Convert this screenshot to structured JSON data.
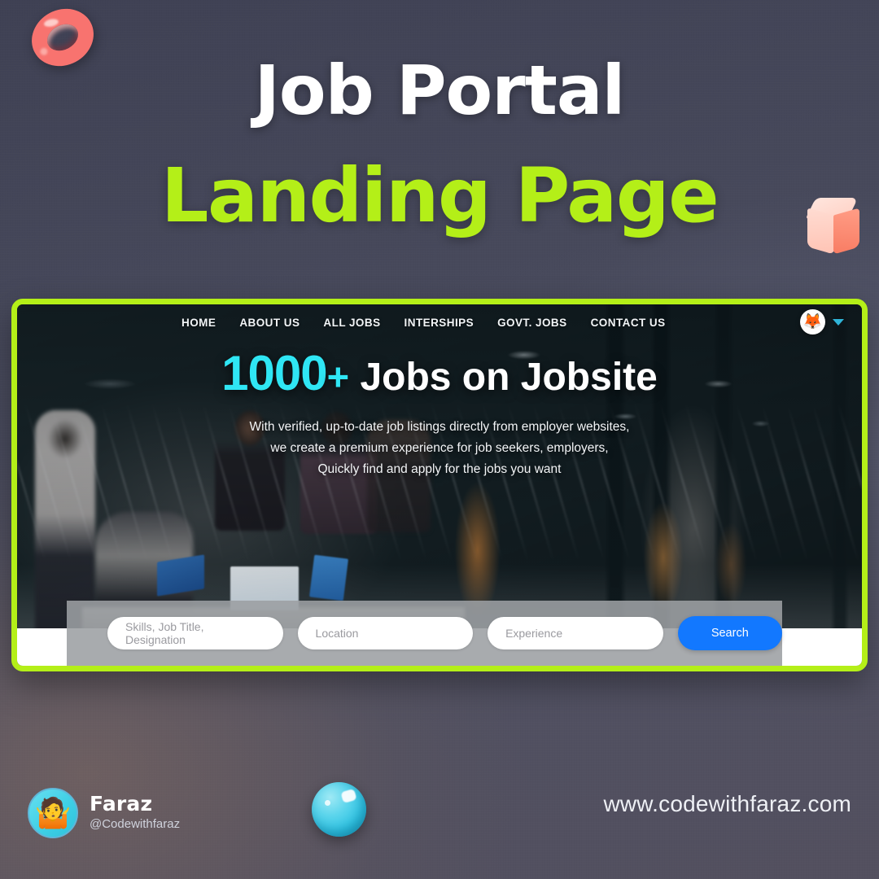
{
  "poster": {
    "title_main": "Job Portal",
    "title_sub": "Landing Page",
    "bg_color": "#484a5c",
    "accent_green": "#b4ef18",
    "accent_cyan": "#2fe6f4",
    "accent_pink": "#f8736f"
  },
  "decorations": [
    {
      "name": "torus",
      "color": "#f8736f"
    },
    {
      "name": "cube",
      "color": "#ffd2c6"
    },
    {
      "name": "sphere",
      "color": "#3fd0e6"
    }
  ],
  "mockup": {
    "frame_color": "#b4ef18",
    "nav": {
      "links": [
        {
          "label": "HOME"
        },
        {
          "label": "ABOUT US"
        },
        {
          "label": "ALL JOBS"
        },
        {
          "label": "INTERSHIPS"
        },
        {
          "label": "GOVT. JOBS"
        },
        {
          "label": "CONTACT US"
        }
      ],
      "avatar_icon": "fox-avatar-icon",
      "avatar_glyph": "🦊",
      "caret_icon": "chevron-down-icon"
    },
    "hero": {
      "count": "1000",
      "plus": "+",
      "rest": "Jobs on Jobsite",
      "paragraph_lines": [
        "With verified, up-to-date job listings directly from employer websites,",
        "we create a premium experience for job seekers, employers,",
        "Quickly find and apply for the jobs you want"
      ]
    },
    "search": {
      "skills_placeholder": "Skills, Job Title, Designation",
      "location_placeholder": "Location",
      "experience_placeholder": "Experience",
      "button_label": "Search",
      "button_color": "#1278ff"
    }
  },
  "footer": {
    "avatar_icon": "shrug-person-avatar-icon",
    "avatar_glyph": "🤷",
    "name": "Faraz",
    "handle": "@Codewithfaraz",
    "url": "www.codewithfaraz.com"
  }
}
